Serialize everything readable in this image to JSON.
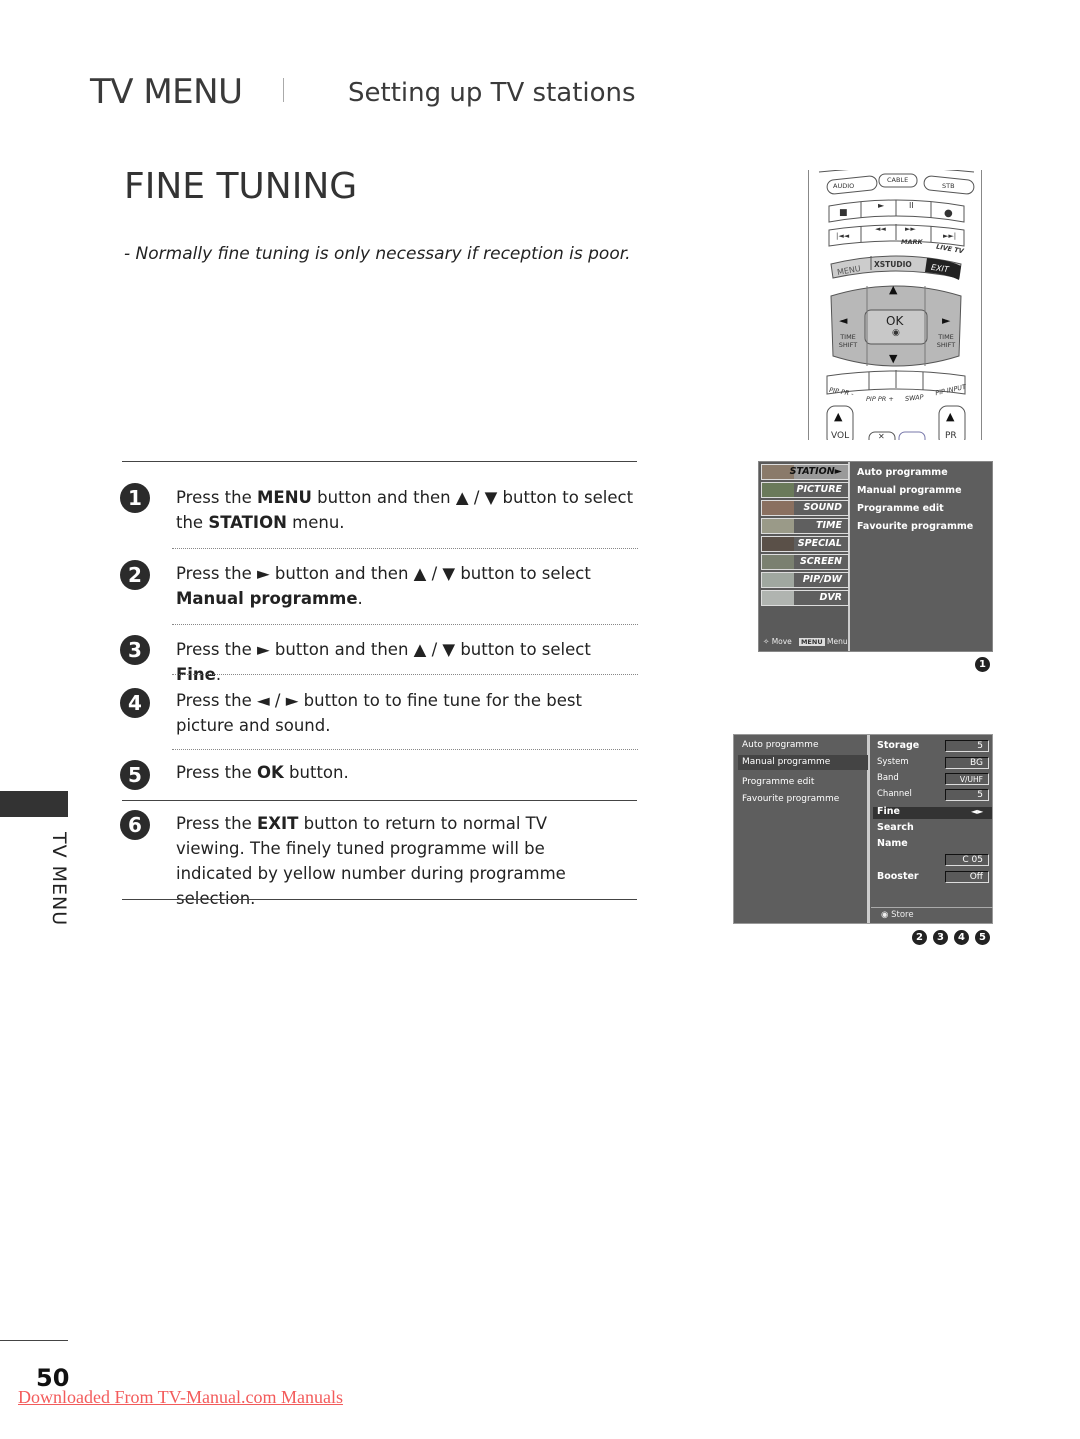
{
  "header": {
    "section": "TV MENU",
    "subtitle": "Setting up TV stations"
  },
  "page_title": "FINE TUNING",
  "note": "- Normally fine tuning is only necessary if reception is poor.",
  "steps": [
    {
      "num": "1",
      "parts": [
        [
          "Press the ",
          ""
        ],
        [
          "MENU",
          "b"
        ],
        [
          " button and then ▲ / ▼ button to select the ",
          ""
        ],
        [
          "STATION",
          "b"
        ],
        [
          " menu.",
          ""
        ]
      ]
    },
    {
      "num": "2",
      "parts": [
        [
          "Press the ► button and then ▲ / ▼ button to select ",
          ""
        ],
        [
          "Manual programme",
          "b"
        ],
        [
          ".",
          ""
        ]
      ]
    },
    {
      "num": "3",
      "parts": [
        [
          "Press the ► button and then ▲ / ▼ button to select ",
          ""
        ],
        [
          "Fine",
          "b"
        ],
        [
          ".",
          ""
        ]
      ]
    },
    {
      "num": "4",
      "parts": [
        [
          "Press the ◄ / ► button to to fine tune for the best picture and sound.",
          ""
        ]
      ]
    },
    {
      "num": "5",
      "parts": [
        [
          "Press the ",
          ""
        ],
        [
          "OK",
          "b"
        ],
        [
          " button.",
          ""
        ]
      ]
    },
    {
      "num": "6",
      "parts": [
        [
          "Press the ",
          ""
        ],
        [
          "EXIT",
          "b"
        ],
        [
          " button to return to normal TV viewing. The finely tuned programme will be indicated by yellow number during programme selection.",
          ""
        ]
      ]
    }
  ],
  "side_tab": "TV MENU",
  "page_number": "50",
  "download_link": "Downloaded From TV-Manual.com Manuals",
  "remote": {
    "audio": "AUDIO",
    "cable": "CABLE",
    "stb": "STB",
    "stop": "■",
    "play": "►",
    "pause": "II",
    "record": "●",
    "skip_back": "|◄◄",
    "rewind": "◄◄",
    "ffwd": "►►",
    "skip_fwd": "►►|",
    "mark": "MARK",
    "live_tv": "LIVE TV",
    "menu": "MENU",
    "xstudio": "XSTUDIO",
    "exit": "EXIT",
    "up": "▲",
    "down": "▼",
    "left": "◄",
    "right": "►",
    "ok": "OK",
    "time_shift_left": "TIME SHIFT",
    "time_shift_right": "TIME SHIFT",
    "pip_pr_minus": "PIP PR -",
    "pip_pr_plus": "PIP PR +",
    "swap": "SWAP",
    "pip_input": "PIP INPUT",
    "vol": "VOL",
    "pr": "PR",
    "mute": "✕"
  },
  "osd1": {
    "menu_items": [
      "STATION",
      "PICTURE",
      "SOUND",
      "TIME",
      "SPECIAL",
      "SCREEN",
      "PIP/DW",
      "DVR"
    ],
    "selected": "STATION",
    "submenu": [
      "Auto programme",
      "Manual programme",
      "Programme edit",
      "Favourite programme"
    ],
    "footer_move": "Move",
    "footer_key": "MENU",
    "footer_menu": "Menu",
    "callout": "1"
  },
  "osd2": {
    "left_items": [
      "Auto programme",
      "Manual programme",
      "Programme edit",
      "Favourite programme"
    ],
    "left_selected": "Manual programme",
    "fields": [
      {
        "label": "Storage",
        "value": "5"
      },
      {
        "label": "System",
        "value": "BG"
      },
      {
        "label": "Band",
        "value": "V/UHF"
      },
      {
        "label": "Channel",
        "value": "5"
      },
      {
        "label": "Fine",
        "value": "◄►"
      },
      {
        "label": "Search",
        "value": ""
      },
      {
        "label": "Name",
        "value": "C 05"
      },
      {
        "label": "Booster",
        "value": "Off"
      }
    ],
    "store": "Store",
    "callouts": [
      "2",
      "3",
      "4",
      "5"
    ]
  },
  "colors": {
    "osd_bg": "#5e5e5e",
    "link": "#f35b5b",
    "text": "#2a2a2a"
  }
}
